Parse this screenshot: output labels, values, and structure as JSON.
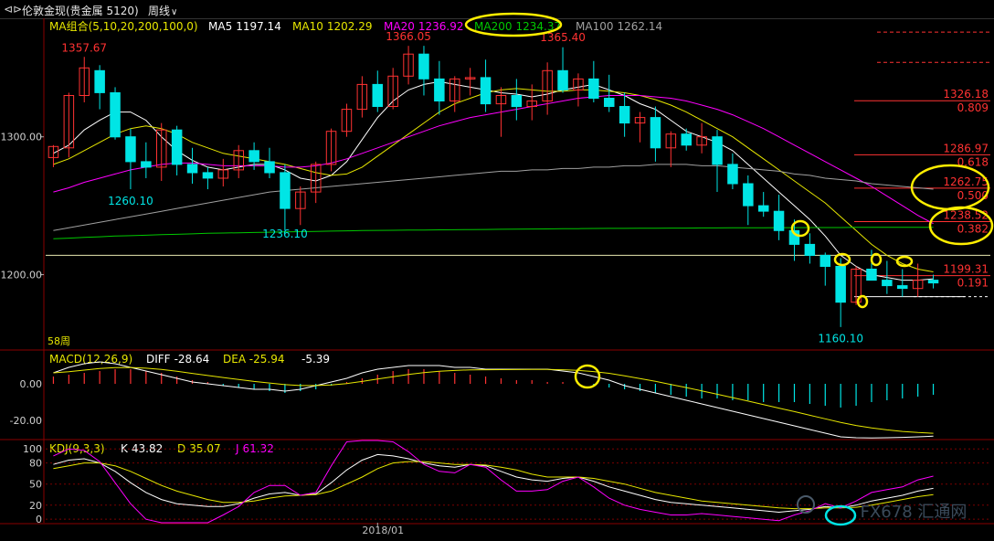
{
  "window": {
    "nav_glyph": "⊲⊳",
    "instrument": "伦敦金现(贵金属 5120)",
    "period": "周线",
    "period_chevron": "∨"
  },
  "colors": {
    "up": "#ff3232",
    "down": "#00e5e5",
    "ma5": "#ffffff",
    "ma10": "#e6e600",
    "ma20": "#ff00ff",
    "ma200": "#00c800",
    "ma100": "#a0a0a0",
    "grid": "#7a0000",
    "fib": "#ff3232",
    "circle_yellow": "#ffee00",
    "circle_cyan": "#00e5e5"
  },
  "chart_data": [
    {
      "type": "candlestick",
      "panel": "price",
      "indicator_label": "MA组合(5,10,20,200,100,0)",
      "ma_legend": [
        {
          "name": "MA5",
          "value": "1197.14"
        },
        {
          "name": "MA10",
          "value": "1202.29"
        },
        {
          "name": "MA20",
          "value": "1236.92"
        },
        {
          "name": "MA200",
          "value": "1234.37"
        },
        {
          "name": "MA100",
          "value": "1262.14"
        }
      ],
      "y_ticks": [
        "1300.00",
        "1200.00"
      ],
      "y_tick_values": [
        1300,
        1200
      ],
      "ylim": [
        1146,
        1386
      ],
      "x_tick_label": "2018/01",
      "x_tick_index": 21,
      "bar_count_label": "58周",
      "candles": [
        [
          1285,
          1294,
          1278,
          1293
        ],
        [
          1292,
          1332,
          1285,
          1330
        ],
        [
          1330,
          1358,
          1325,
          1350
        ],
        [
          1348,
          1352,
          1320,
          1332
        ],
        [
          1332,
          1336,
          1298,
          1300
        ],
        [
          1300,
          1306,
          1262,
          1282
        ],
        [
          1282,
          1296,
          1270,
          1278
        ],
        [
          1278,
          1310,
          1268,
          1305
        ],
        [
          1305,
          1308,
          1272,
          1280
        ],
        [
          1280,
          1292,
          1266,
          1274
        ],
        [
          1274,
          1278,
          1262,
          1270
        ],
        [
          1270,
          1284,
          1264,
          1276
        ],
        [
          1276,
          1294,
          1270,
          1290
        ],
        [
          1290,
          1296,
          1276,
          1282
        ],
        [
          1282,
          1292,
          1270,
          1274
        ],
        [
          1274,
          1280,
          1232,
          1248
        ],
        [
          1248,
          1264,
          1236,
          1260
        ],
        [
          1260,
          1282,
          1252,
          1280
        ],
        [
          1280,
          1306,
          1275,
          1304
        ],
        [
          1304,
          1324,
          1300,
          1320
        ],
        [
          1320,
          1344,
          1314,
          1338
        ],
        [
          1338,
          1348,
          1318,
          1322
        ],
        [
          1322,
          1350,
          1320,
          1344
        ],
        [
          1344,
          1366,
          1338,
          1360
        ],
        [
          1360,
          1366,
          1330,
          1342
        ],
        [
          1342,
          1355,
          1316,
          1326
        ],
        [
          1326,
          1344,
          1318,
          1342
        ],
        [
          1342,
          1350,
          1330,
          1343
        ],
        [
          1343,
          1356,
          1318,
          1324
        ],
        [
          1324,
          1336,
          1300,
          1330
        ],
        [
          1330,
          1342,
          1312,
          1322
        ],
        [
          1322,
          1338,
          1312,
          1326
        ],
        [
          1326,
          1354,
          1316,
          1348
        ],
        [
          1348,
          1365,
          1332,
          1334
        ],
        [
          1334,
          1346,
          1322,
          1342
        ],
        [
          1342,
          1355,
          1325,
          1328
        ],
        [
          1328,
          1345,
          1318,
          1322
        ],
        [
          1322,
          1332,
          1300,
          1310
        ],
        [
          1310,
          1318,
          1296,
          1314
        ],
        [
          1314,
          1322,
          1282,
          1292
        ],
        [
          1292,
          1304,
          1278,
          1302
        ],
        [
          1302,
          1306,
          1290,
          1294
        ],
        [
          1294,
          1310,
          1288,
          1300
        ],
        [
          1300,
          1305,
          1260,
          1280
        ],
        [
          1280,
          1288,
          1262,
          1266
        ],
        [
          1266,
          1272,
          1236,
          1250
        ],
        [
          1250,
          1260,
          1242,
          1246
        ],
        [
          1246,
          1258,
          1225,
          1232
        ],
        [
          1232,
          1240,
          1210,
          1222
        ],
        [
          1222,
          1230,
          1208,
          1214
        ],
        [
          1214,
          1216,
          1192,
          1206
        ],
        [
          1206,
          1212,
          1162,
          1180
        ],
        [
          1180,
          1206,
          1178,
          1204
        ],
        [
          1204,
          1218,
          1196,
          1196
        ],
        [
          1196,
          1210,
          1186,
          1192
        ],
        [
          1192,
          1204,
          1184,
          1190
        ],
        [
          1190,
          1208,
          1184,
          1196
        ],
        [
          1196,
          1200,
          1190,
          1194
        ]
      ],
      "ma_series": [
        {
          "name": "MA5",
          "values": [
            1288,
            1294,
            1305,
            1312,
            1318,
            1318,
            1312,
            1300,
            1290,
            1283,
            1278,
            1276,
            1278,
            1280,
            1280,
            1276,
            1270,
            1268,
            1272,
            1282,
            1298,
            1314,
            1326,
            1334,
            1338,
            1340,
            1338,
            1336,
            1334,
            1332,
            1331,
            1329,
            1331,
            1334,
            1336,
            1338,
            1334,
            1330,
            1324,
            1320,
            1312,
            1304,
            1300,
            1296,
            1290,
            1280,
            1270,
            1260,
            1250,
            1240,
            1228,
            1214,
            1206,
            1200,
            1198,
            1196,
            1196,
            1197
          ]
        },
        {
          "name": "MA10",
          "values": [
            1280,
            1284,
            1290,
            1296,
            1302,
            1306,
            1308,
            1306,
            1302,
            1296,
            1292,
            1288,
            1286,
            1284,
            1282,
            1280,
            1277,
            1274,
            1272,
            1273,
            1278,
            1286,
            1294,
            1302,
            1310,
            1318,
            1324,
            1328,
            1332,
            1334,
            1335,
            1334,
            1333,
            1333,
            1334,
            1334,
            1333,
            1332,
            1330,
            1327,
            1323,
            1318,
            1312,
            1306,
            1300,
            1292,
            1284,
            1276,
            1268,
            1260,
            1252,
            1242,
            1232,
            1222,
            1214,
            1208,
            1204,
            1202
          ]
        },
        {
          "name": "MA20",
          "values": [
            1260,
            1263,
            1267,
            1270,
            1273,
            1276,
            1278,
            1280,
            1281,
            1281,
            1280,
            1279,
            1279,
            1279,
            1279,
            1278,
            1278,
            1279,
            1281,
            1284,
            1288,
            1292,
            1296,
            1300,
            1304,
            1308,
            1311,
            1314,
            1316,
            1318,
            1320,
            1322,
            1324,
            1326,
            1328,
            1329,
            1330,
            1330,
            1330,
            1329,
            1328,
            1326,
            1323,
            1320,
            1316,
            1311,
            1306,
            1300,
            1294,
            1288,
            1282,
            1276,
            1270,
            1264,
            1257,
            1250,
            1243,
            1237
          ]
        },
        {
          "name": "MA100",
          "values": [
            1232,
            1234,
            1236,
            1238,
            1240,
            1242,
            1244,
            1246,
            1248,
            1250,
            1252,
            1254,
            1256,
            1258,
            1260,
            1261,
            1262,
            1263,
            1264,
            1265,
            1266,
            1267,
            1268,
            1269,
            1270,
            1271,
            1272,
            1273,
            1274,
            1275,
            1275,
            1276,
            1276,
            1277,
            1277,
            1278,
            1278,
            1279,
            1279,
            1280,
            1280,
            1280,
            1279,
            1279,
            1278,
            1277,
            1276,
            1275,
            1273,
            1272,
            1270,
            1269,
            1268,
            1266,
            1265,
            1264,
            1263,
            1262
          ]
        },
        {
          "name": "MA200",
          "values": [
            1226,
            1226.5,
            1227,
            1227.5,
            1228,
            1228.3,
            1228.6,
            1229,
            1229.3,
            1229.6,
            1230,
            1230.2,
            1230.4,
            1230.6,
            1230.8,
            1231,
            1231.2,
            1231.4,
            1231.6,
            1231.8,
            1232,
            1232.1,
            1232.2,
            1232.3,
            1232.4,
            1232.5,
            1232.6,
            1232.7,
            1232.8,
            1232.9,
            1233,
            1233.1,
            1233.2,
            1233.3,
            1233.4,
            1233.5,
            1233.6,
            1233.6,
            1233.7,
            1233.7,
            1233.8,
            1233.8,
            1233.9,
            1233.9,
            1234,
            1234,
            1234,
            1234.1,
            1234.1,
            1234.2,
            1234.2,
            1234.2,
            1234.3,
            1234.3,
            1234.3,
            1234.3,
            1234.4,
            1234.4
          ]
        }
      ],
      "price_annotations": [
        {
          "text": "1357.67",
          "index": 2,
          "value": 1357.67,
          "pos": "above"
        },
        {
          "text": "1260.10",
          "index": 5,
          "value": 1260.1,
          "pos": "below"
        },
        {
          "text": "1236.10",
          "index": 15,
          "value": 1236.1,
          "pos": "below"
        },
        {
          "text": "1366.05",
          "index": 23,
          "value": 1366.05,
          "pos": "above"
        },
        {
          "text": "1365.40",
          "index": 33,
          "value": 1365.4,
          "pos": "above"
        },
        {
          "text": "1160.10",
          "index": 51,
          "value": 1160.1,
          "pos": "below"
        }
      ],
      "horizontal_line": 1214,
      "fib_levels": [
        {
          "price": "1326.18",
          "ratio": "0.809",
          "value": 1326.18
        },
        {
          "price": "1286.97",
          "ratio": "0.618",
          "value": 1286.97
        },
        {
          "price": "1262.75",
          "ratio": "0.500",
          "value": 1262.75
        },
        {
          "price": "1238.52",
          "ratio": "0.382",
          "value": 1238.52
        },
        {
          "price": "1199.31",
          "ratio": "0.191",
          "value": 1199.31
        }
      ],
      "fib_guides": [
        1376,
        1354
      ],
      "current_price_line": 1184
    },
    {
      "type": "bar",
      "panel": "macd",
      "indicator_label": "MACD(12,26,9)",
      "legend": [
        {
          "name": "DIFF",
          "value": "-28.64"
        },
        {
          "name": "DEA",
          "value": "-25.94"
        },
        {
          "name": "",
          "value": "-5.39"
        }
      ],
      "y_ticks": [
        "0.00",
        "-20.00"
      ],
      "y_tick_values": [
        0,
        -20
      ],
      "ylim": [
        -30,
        18
      ],
      "hist": [
        4,
        5,
        6,
        7,
        8,
        8,
        7,
        6,
        4,
        2,
        1,
        -1,
        -2,
        -3,
        -4,
        -5,
        -4,
        -3,
        -1,
        1,
        3,
        5,
        7,
        8,
        8,
        7,
        6,
        5,
        4,
        3,
        2,
        2,
        1,
        1,
        0,
        -1,
        -2,
        -3,
        -4,
        -5,
        -6,
        -7,
        -8,
        -8,
        -9,
        -9,
        -10,
        -10,
        -10,
        -11,
        -12,
        -13,
        -12,
        -10,
        -9,
        -8,
        -7,
        -6
      ],
      "diff": [
        6,
        9,
        11,
        12,
        11,
        9,
        7,
        5,
        3,
        1,
        0,
        -1,
        -2,
        -3,
        -3,
        -4,
        -3,
        -1,
        1,
        3,
        6,
        8,
        9,
        10,
        10,
        10,
        9,
        9,
        8,
        8,
        8,
        8,
        8,
        7,
        6,
        4,
        2,
        -1,
        -3,
        -5,
        -7,
        -9,
        -11,
        -13,
        -15,
        -17,
        -19,
        -21,
        -23,
        -25,
        -27,
        -29,
        -29.5,
        -29.6,
        -29.5,
        -29.3,
        -29,
        -28.64
      ]
    },
    {
      "type": "line",
      "panel": "kdj",
      "indicator_label": "KDJ(9,3,3)",
      "legend": [
        {
          "name": "K",
          "value": "43.82"
        },
        {
          "name": "D",
          "value": "35.07"
        },
        {
          "name": "J",
          "value": "61.32"
        }
      ],
      "y_ticks": [
        "100",
        "80",
        "50",
        "20",
        "0"
      ],
      "y_tick_values": [
        100,
        80,
        50,
        20,
        0
      ],
      "ylim": [
        -5,
        112
      ],
      "series": [
        {
          "name": "K",
          "values": [
            78,
            84,
            86,
            80,
            68,
            52,
            38,
            28,
            22,
            20,
            18,
            18,
            22,
            30,
            36,
            38,
            34,
            36,
            52,
            70,
            84,
            92,
            90,
            86,
            80,
            76,
            74,
            78,
            76,
            68,
            60,
            56,
            54,
            58,
            60,
            54,
            46,
            40,
            34,
            28,
            24,
            22,
            20,
            18,
            16,
            14,
            12,
            10,
            12,
            14,
            18,
            16,
            20,
            26,
            30,
            34,
            40,
            43.82
          ]
        },
        {
          "name": "D",
          "values": [
            72,
            76,
            80,
            80,
            76,
            68,
            58,
            48,
            40,
            34,
            28,
            24,
            24,
            26,
            30,
            33,
            34,
            35,
            40,
            50,
            60,
            72,
            80,
            82,
            82,
            80,
            78,
            78,
            77,
            74,
            70,
            64,
            60,
            60,
            60,
            58,
            54,
            50,
            44,
            38,
            34,
            30,
            26,
            24,
            22,
            20,
            18,
            16,
            15,
            15,
            16,
            16,
            17,
            20,
            24,
            28,
            32,
            35.07
          ]
        },
        {
          "name": "J",
          "values": [
            90,
            100,
            98,
            82,
            52,
            22,
            0,
            -5,
            -5,
            -5,
            -5,
            6,
            18,
            38,
            48,
            48,
            34,
            38,
            76,
            110,
            112,
            112,
            110,
            96,
            78,
            68,
            66,
            78,
            74,
            56,
            40,
            40,
            42,
            54,
            60,
            46,
            30,
            20,
            14,
            10,
            6,
            6,
            8,
            6,
            4,
            2,
            0,
            -2,
            6,
            12,
            22,
            16,
            26,
            38,
            42,
            46,
            56,
            61.32
          ]
        }
      ],
      "watermark": "FX678 汇通网"
    }
  ]
}
